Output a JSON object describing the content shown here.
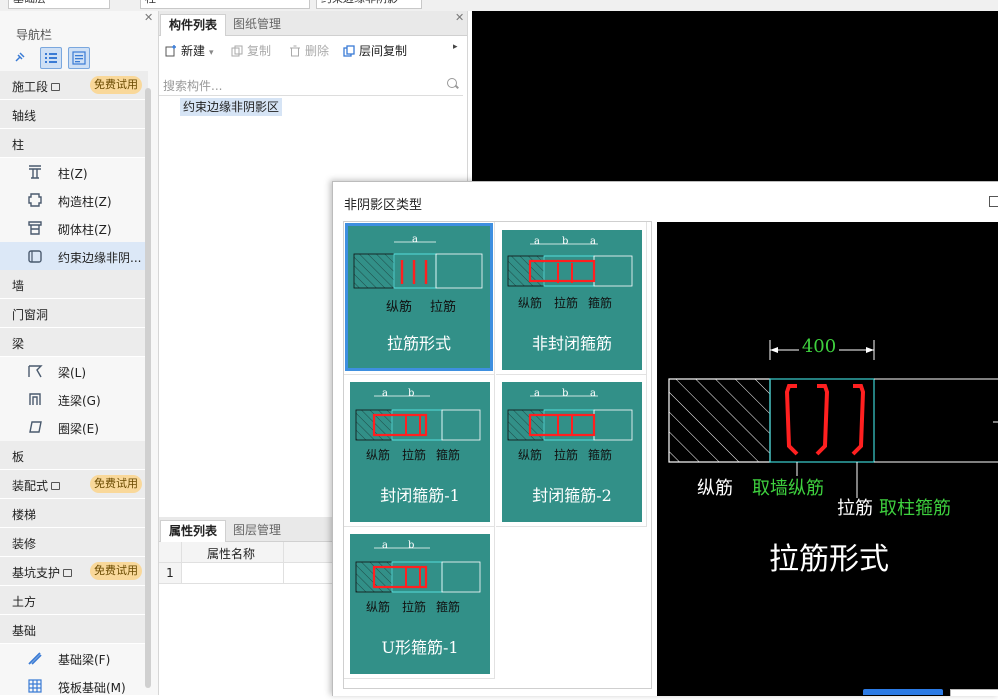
{
  "topbar": {
    "box1": "基础层",
    "box2": "柱",
    "box3": "约束边缘非阴影"
  },
  "nav": {
    "title": "导航栏",
    "list": [
      {
        "kind": "cat",
        "label": "施工段",
        "lock": true,
        "badge": "免费试用"
      },
      {
        "kind": "cat",
        "label": "轴线"
      },
      {
        "kind": "cat",
        "label": "柱"
      },
      {
        "kind": "item",
        "label": "柱(Z)",
        "icon": "column-icon"
      },
      {
        "kind": "item",
        "label": "构造柱(Z)",
        "icon": "construct-column-icon"
      },
      {
        "kind": "item",
        "label": "砌体柱(Z)",
        "icon": "masonry-column-icon"
      },
      {
        "kind": "item",
        "label": "约束边缘非阴...",
        "icon": "boundary-icon",
        "selected": true
      },
      {
        "kind": "cat",
        "label": "墙"
      },
      {
        "kind": "cat",
        "label": "门窗洞"
      },
      {
        "kind": "cat",
        "label": "梁"
      },
      {
        "kind": "item",
        "label": "梁(L)",
        "icon": "beam-icon"
      },
      {
        "kind": "item",
        "label": "连梁(G)",
        "icon": "link-beam-icon"
      },
      {
        "kind": "item",
        "label": "圈梁(E)",
        "icon": "ring-beam-icon"
      },
      {
        "kind": "cat",
        "label": "板"
      },
      {
        "kind": "cat",
        "label": "装配式",
        "lock": true,
        "badge": "免费试用"
      },
      {
        "kind": "cat",
        "label": "楼梯"
      },
      {
        "kind": "cat",
        "label": "装修"
      },
      {
        "kind": "cat",
        "label": "基坑支护",
        "lock": true,
        "badge": "免费试用"
      },
      {
        "kind": "cat",
        "label": "土方"
      },
      {
        "kind": "cat",
        "label": "基础"
      },
      {
        "kind": "item",
        "label": "基础梁(F)",
        "icon": "foundation-beam-icon"
      },
      {
        "kind": "item",
        "label": "筏板基础(M)",
        "icon": "raft-foundation-icon"
      }
    ]
  },
  "comp": {
    "tab_active": "构件列表",
    "tab_other": "图纸管理",
    "new_label": "新建",
    "copy_label": "复制",
    "delete_label": "删除",
    "floor_copy_label": "层间复制",
    "search_placeholder": "搜索构件...",
    "item": "约束边缘非阴影区"
  },
  "prop": {
    "tab_active": "属性列表",
    "tab_other": "图层管理",
    "col_header": "属性名称",
    "row1": "1"
  },
  "dialog": {
    "title": "非阴影区类型",
    "cards": [
      {
        "caption": "拉筋形式",
        "labels": [
          "纵筋",
          "拉筋"
        ],
        "dims": [
          "a"
        ]
      },
      {
        "caption": "非封闭箍筋",
        "labels": [
          "纵筋",
          "拉筋",
          "箍筋"
        ],
        "dims": [
          "a",
          "b",
          "a"
        ]
      },
      {
        "caption": "封闭箍筋-1",
        "labels": [
          "纵筋",
          "拉筋",
          "箍筋"
        ],
        "dims": [
          "a",
          "b"
        ]
      },
      {
        "caption": "封闭箍筋-2",
        "labels": [
          "纵筋",
          "拉筋",
          "箍筋"
        ],
        "dims": [
          "a",
          "b",
          "a"
        ]
      },
      {
        "caption": "U形箍筋-1",
        "labels": [
          "纵筋",
          "拉筋",
          "箍筋"
        ],
        "dims": [
          "a",
          "b"
        ]
      }
    ],
    "preview": {
      "dim": "400",
      "long_bar": "纵筋",
      "long_bar_take": "取墙纵筋",
      "tie_bar": "拉筋",
      "tie_bar_take": "取柱箍筋",
      "caption": "拉筋形式"
    }
  },
  "colors": {
    "card": "#329088",
    "accent": "#3e8fe0",
    "badge": "#f9d89a",
    "green_text": "#3ed03e"
  }
}
